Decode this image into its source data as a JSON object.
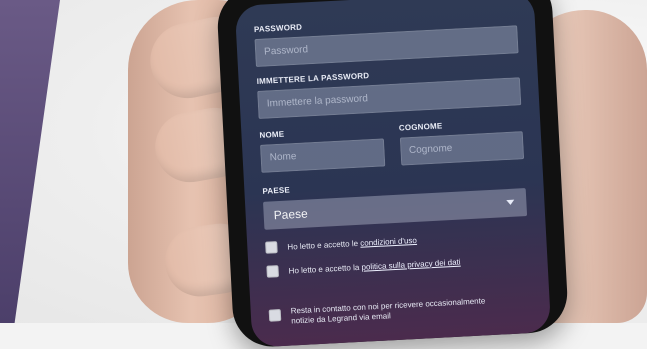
{
  "form": {
    "password_label": "PASSWORD",
    "password_placeholder": "Password",
    "confirm_label": "IMMETTERE LA PASSWORD",
    "confirm_placeholder": "Immettere la password",
    "first_name_label": "NOME",
    "first_name_placeholder": "Nome",
    "last_name_label": "COGNOME",
    "last_name_placeholder": "Cognome",
    "country_label": "PAESE",
    "country_value": "Paese",
    "terms_prefix": "Ho letto e accetto le",
    "terms_link": "condizioni d'uso",
    "privacy_prefix": "Ho letto e accetto la",
    "privacy_link": "politica sulla privacy dei dati",
    "marketing_line1": "Resta in contatto con noi per ricevere occasionalmente",
    "marketing_line2": "notizie da Legrand via email"
  },
  "colors": {
    "left_band": "#5a4b78",
    "screen_top": "#2f3a55",
    "screen_bottom": "#4b2b4d"
  }
}
